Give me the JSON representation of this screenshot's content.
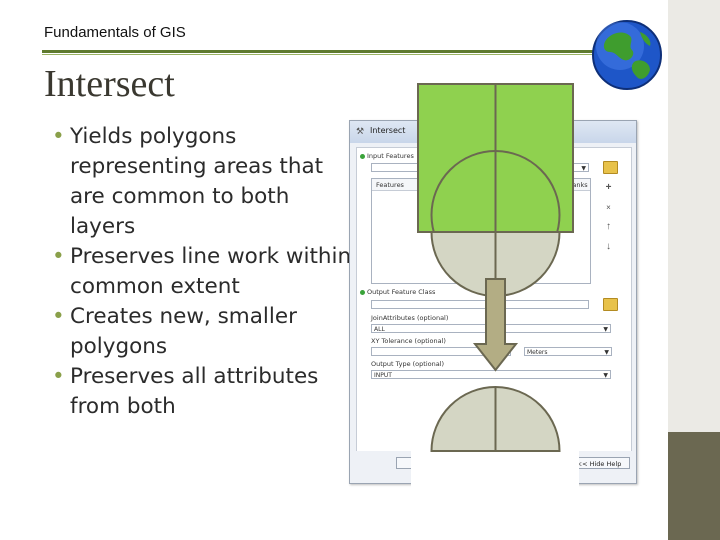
{
  "header": {
    "course_title": "Fundamentals of GIS",
    "accent_color": "#5f7a2f",
    "logo_icon": "globe-icon"
  },
  "slide": {
    "title": "Intersect",
    "bullets": [
      "Yields polygons representing areas that are common to both layers",
      "Preserves line work within common extent",
      "Creates new, smaller polygons",
      "Preserves all attributes from both"
    ],
    "bullet_color": "#8aa04a"
  },
  "dialog": {
    "title": "Intersect",
    "input_features_label": "Input Features",
    "features_column": "Features",
    "ranks_column": "Ranks",
    "output_label": "Output Feature Class",
    "join_label": "JoinAttributes (optional)",
    "join_value": "ALL",
    "xy_label": "XY Tolerance (optional)",
    "xy_unit": "Meters",
    "output_type_label": "Output Type (optional)",
    "output_type_value": "INPUT",
    "hide_help": "<< Hide Help"
  },
  "diagram": {
    "square_color": "#8fd14f",
    "result_color": "#d4d6c4",
    "arrow_color": "#b3ad84",
    "stroke_color": "#6b6851"
  }
}
